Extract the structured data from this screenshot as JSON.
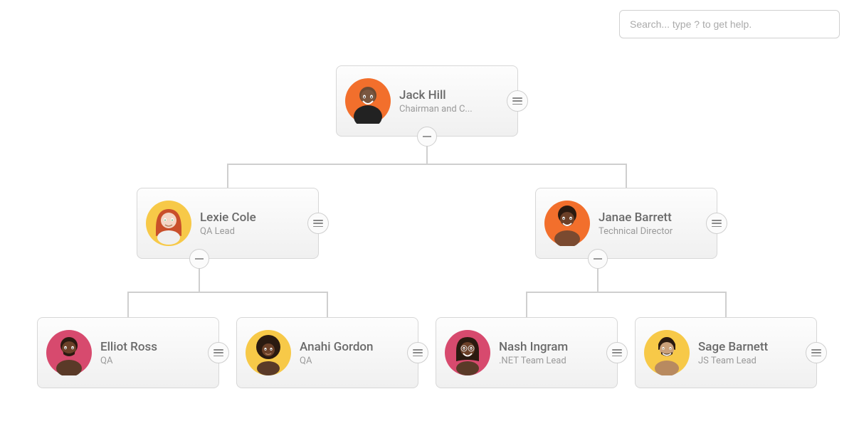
{
  "search": {
    "placeholder": "Search... type ? to get help."
  },
  "colors": {
    "orange": "#f26f2c",
    "yellow": "#f7c948",
    "pink": "#d74a6e"
  },
  "nodes": {
    "root": {
      "name": "Jack Hill",
      "title": "Chairman and C...",
      "avatarBg": "#f26f2c"
    },
    "lexie": {
      "name": "Lexie Cole",
      "title": "QA Lead",
      "avatarBg": "#f7c948"
    },
    "janae": {
      "name": "Janae Barrett",
      "title": "Technical Director",
      "avatarBg": "#f26f2c"
    },
    "elliot": {
      "name": "Elliot Ross",
      "title": "QA",
      "avatarBg": "#d74a6e"
    },
    "anahi": {
      "name": "Anahi Gordon",
      "title": "QA",
      "avatarBg": "#f7c948"
    },
    "nash": {
      "name": "Nash Ingram",
      "title": ".NET Team Lead",
      "avatarBg": "#d74a6e"
    },
    "sage": {
      "name": "Sage Barnett",
      "title": "JS Team Lead",
      "avatarBg": "#f7c948"
    }
  }
}
